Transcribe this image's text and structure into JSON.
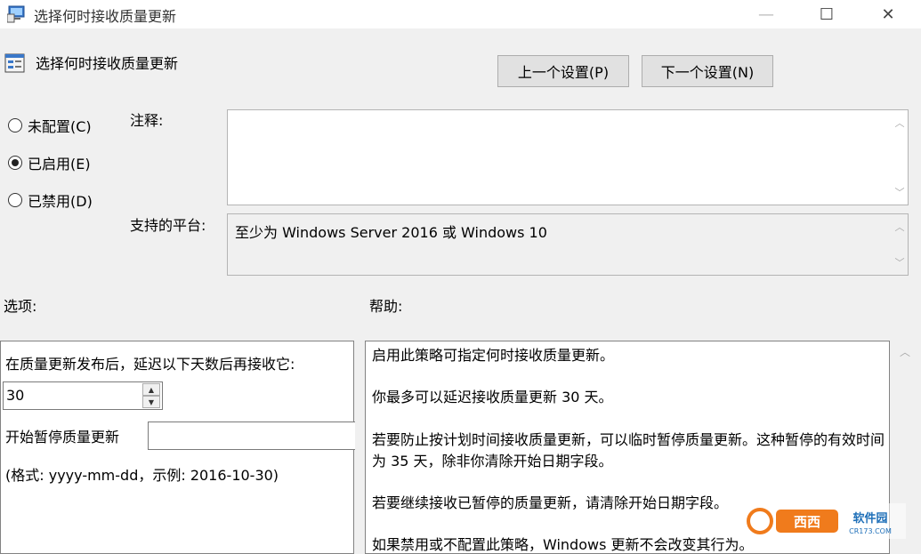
{
  "window": {
    "title": "选择何时接收质量更新",
    "minimize_glyph": "—",
    "maximize_glyph": "☐",
    "close_glyph": "✕"
  },
  "header": {
    "policy_name": "选择何时接收质量更新",
    "prev_button": "上一个设置(P)",
    "next_button": "下一个设置(N)"
  },
  "state": {
    "options": [
      {
        "label": "未配置(C)",
        "checked": false
      },
      {
        "label": "已启用(E)",
        "checked": true
      },
      {
        "label": "已禁用(D)",
        "checked": false
      }
    ]
  },
  "comment": {
    "label": "注释:",
    "value": ""
  },
  "platform": {
    "label": "支持的平台:",
    "value": "至少为 Windows Server 2016 或 Windows 10"
  },
  "options_section": {
    "label": "选项:",
    "defer_label": "在质量更新发布后，延迟以下天数后再接收它:",
    "defer_value": "30",
    "pause_label": "开始暂停质量更新",
    "pause_value": "",
    "format_hint": "(格式: yyyy-mm-dd，示例: 2016-10-30)"
  },
  "help_section": {
    "label": "帮助:",
    "paragraphs": [
      "启用此策略可指定何时接收质量更新。",
      "你最多可以延迟接收质量更新 30 天。",
      "若要防止按计划时间接收质量更新，可以临时暂停质量更新。这种暂停的有效时间为 35 天，除非你清除开始日期字段。",
      "若要继续接收已暂停的质量更新，请清除开始日期字段。",
      "如果禁用或不配置此策略，Windows 更新不会改变其行为。"
    ]
  },
  "icons": {
    "app": "policy-app-icon",
    "policy": "policy-setting-icon",
    "scroll_up": "chevron-up-icon",
    "scroll_down": "chevron-down-icon",
    "spin_up": "triangle-up-icon",
    "spin_down": "triangle-down-icon"
  },
  "watermark": {
    "brand": "西西软件园",
    "url": "CR173.COM"
  },
  "colors": {
    "window_bg": "#f0f0f0",
    "button_bg": "#e1e1e1",
    "border": "#adadad"
  }
}
